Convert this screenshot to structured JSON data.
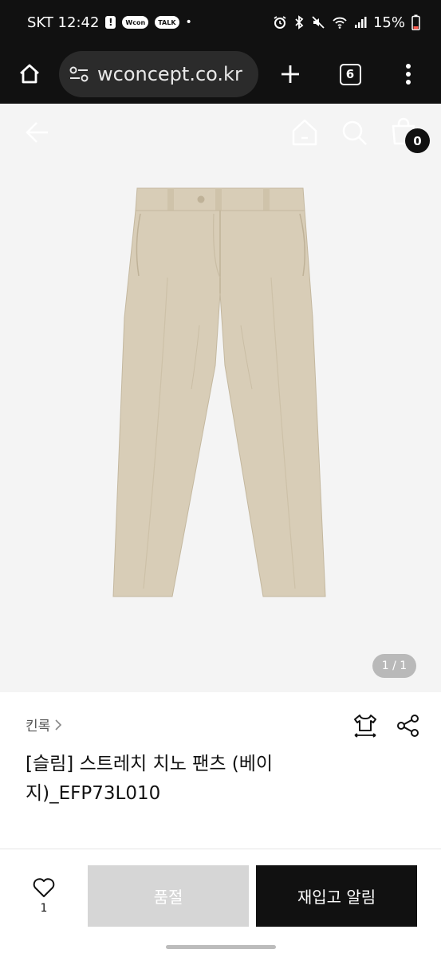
{
  "status_bar": {
    "carrier_time": "SKT 12:42",
    "notif_alert": "!",
    "notif_wcon": "Wcon",
    "notif_talk": "TALK",
    "dot": "•",
    "battery": "15%"
  },
  "browser": {
    "url": "wconcept.co.kr",
    "tab_count": "6"
  },
  "product_nav": {
    "cart_count": "0"
  },
  "gallery": {
    "page_indicator": "1 / 1",
    "product_color": "#d8cdb7"
  },
  "product": {
    "brand": "킨록",
    "title": "[슬림] 스트레치 치노 팬츠 (베이지)_EFP73L010"
  },
  "bottom_bar": {
    "wish_count": "1",
    "soldout_label": "품절",
    "restock_label": "재입고 알림"
  },
  "colors": {
    "status_bg": "#111111",
    "image_bg": "#f4f4f4",
    "soldout_bg": "#d6d6d6",
    "primary_btn": "#111111"
  }
}
